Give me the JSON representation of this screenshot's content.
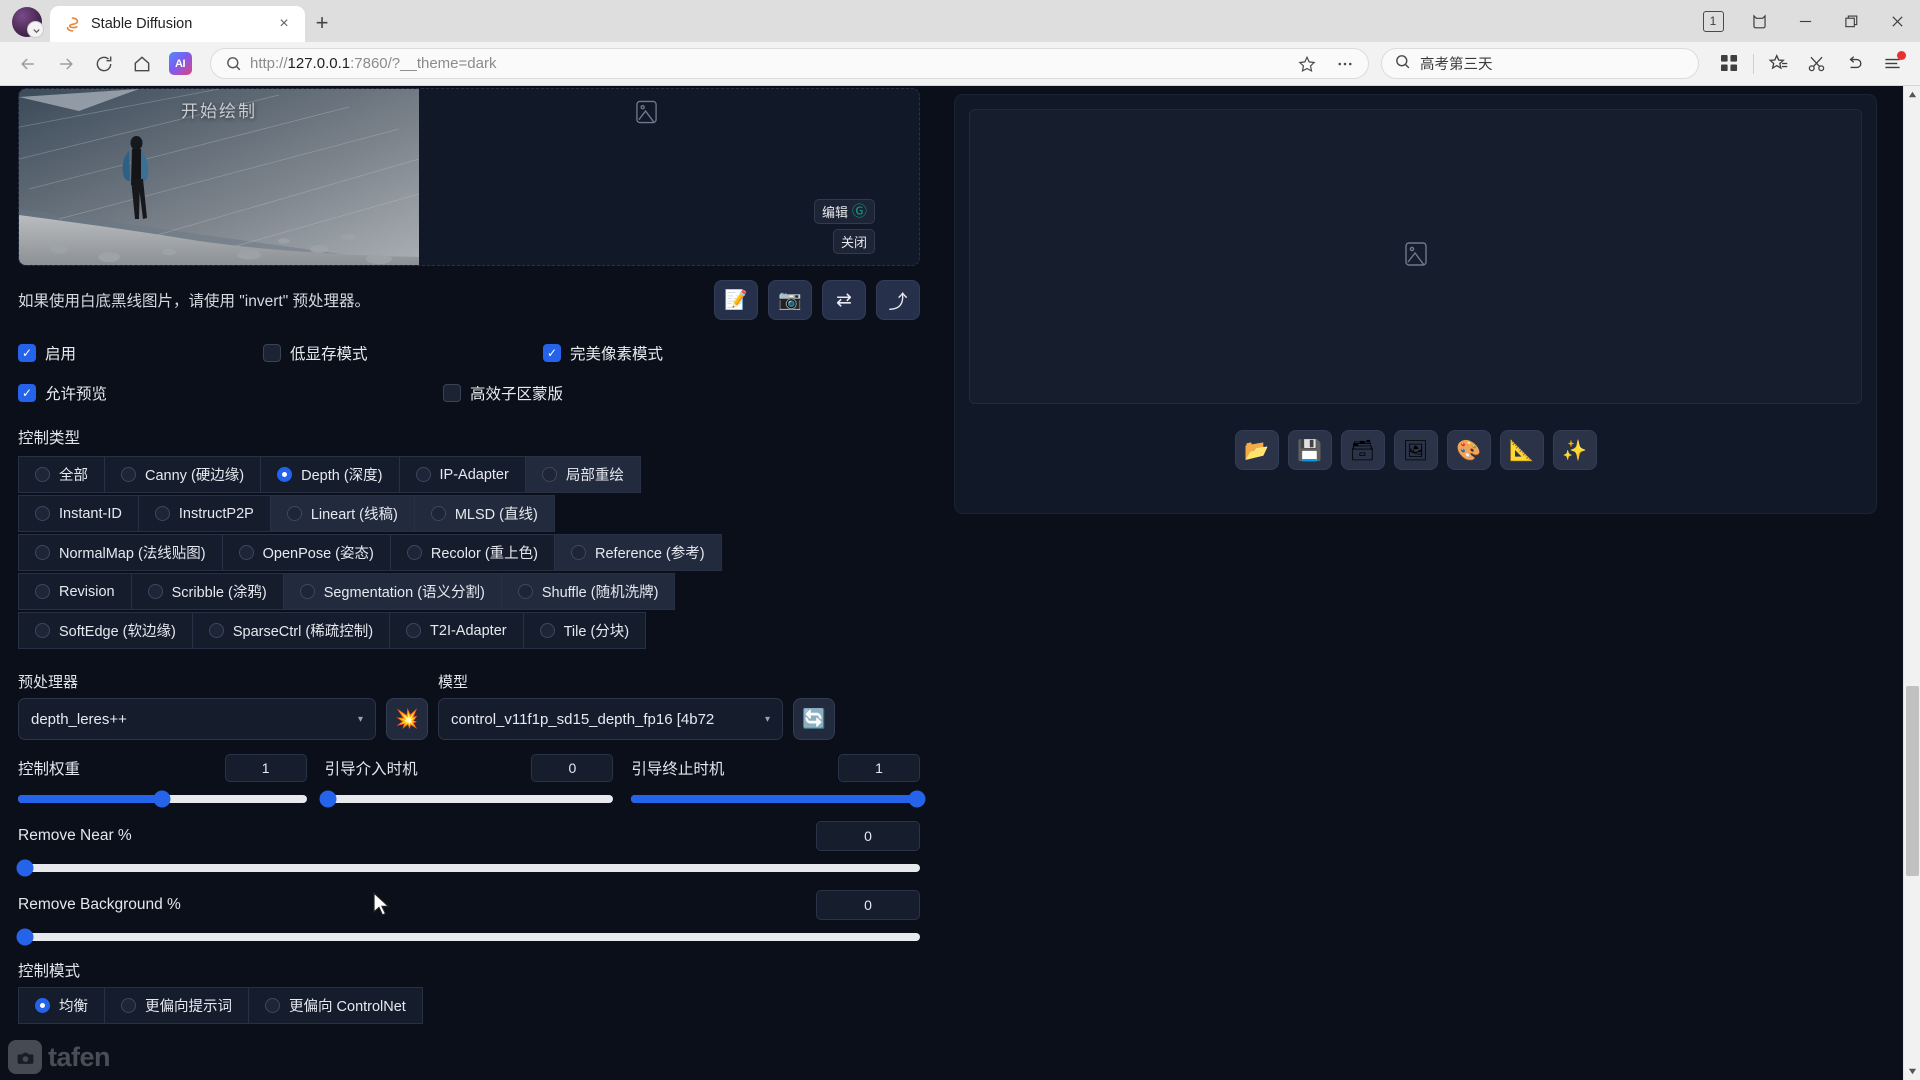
{
  "browser": {
    "tab": {
      "title": "Stable Diffusion",
      "favicon": "stable-diffusion-favicon",
      "close": "×"
    },
    "new_tab": "+",
    "window_controls": {
      "tab_count": "1",
      "collections": "collections-icon",
      "minimize": "—",
      "maximize": "maximize-icon",
      "close": "✕"
    },
    "toolbar": {
      "back": "←",
      "forward": "→",
      "reload": "⟳",
      "home": "⌂",
      "ai_badge": "AI",
      "url_prefix": "http://",
      "url_host": "127.0.0.1",
      "url_suffix": ":7860/?__theme=dark",
      "url_full": "http://127.0.0.1:7860/?__theme=dark",
      "bookmark": "☆",
      "more": "⋯",
      "search_query": "高考第三天",
      "apps": "apps-grid-icon",
      "favorites": "favorites-star-icon",
      "clip": "scissors-icon",
      "undo": "undo-arrow-icon",
      "menu": "hamburger-menu-icon"
    }
  },
  "controlnet": {
    "image": {
      "overlay_text": "开始绘制",
      "edit_label": "编辑",
      "edit_icon": "Ⓖ",
      "close_label": "关闭",
      "placeholder_icon": "image-placeholder-icon"
    },
    "hint": "如果使用白底黑线图片，请使用 \"invert\" 预处理器。",
    "tool_buttons": [
      {
        "name": "memo-icon",
        "glyph": "📝"
      },
      {
        "name": "camera-icon",
        "glyph": "📷"
      },
      {
        "name": "swap-arrows-icon",
        "glyph": "⇄"
      },
      {
        "name": "send-arrow-icon",
        "glyph": "⤴"
      }
    ],
    "checkboxes_row1": [
      {
        "label": "启用",
        "checked": true
      },
      {
        "label": "低显存模式",
        "checked": false
      },
      {
        "label": "完美像素模式",
        "checked": true
      }
    ],
    "checkboxes_row2": [
      {
        "label": "允许预览",
        "checked": true
      },
      {
        "label": "高效子区蒙版",
        "checked": false
      }
    ],
    "control_type_label": "控制类型",
    "control_types": [
      [
        {
          "label": "全部",
          "selected": false
        },
        {
          "label": "Canny (硬边缘)",
          "selected": false
        },
        {
          "label": "Depth (深度)",
          "selected": true
        },
        {
          "label": "IP-Adapter",
          "selected": false
        },
        {
          "label": "局部重绘",
          "selected": false,
          "hover": true
        }
      ],
      [
        {
          "label": "Instant-ID",
          "selected": false
        },
        {
          "label": "InstructP2P",
          "selected": false
        },
        {
          "label": "Lineart (线稿)",
          "selected": false,
          "hover": true
        },
        {
          "label": "MLSD (直线)",
          "selected": false,
          "hover": true
        }
      ],
      [
        {
          "label": "NormalMap (法线贴图)",
          "selected": false
        },
        {
          "label": "OpenPose (姿态)",
          "selected": false
        },
        {
          "label": "Recolor (重上色)",
          "selected": false
        },
        {
          "label": "Reference (参考)",
          "selected": false,
          "hover": true
        }
      ],
      [
        {
          "label": "Revision",
          "selected": false
        },
        {
          "label": "Scribble (涂鸦)",
          "selected": false
        },
        {
          "label": "Segmentation (语义分割)",
          "selected": false,
          "hover": true
        },
        {
          "label": "Shuffle (随机洗牌)",
          "selected": false,
          "hover": true
        }
      ],
      [
        {
          "label": "SoftEdge (软边缘)",
          "selected": false
        },
        {
          "label": "SparseCtrl (稀疏控制)",
          "selected": false
        },
        {
          "label": "T2I-Adapter",
          "selected": false
        },
        {
          "label": "Tile (分块)",
          "selected": false
        }
      ]
    ],
    "preprocessor": {
      "label": "预处理器",
      "value": "depth_leres++",
      "caret": "▾"
    },
    "explode_button": "💥",
    "model": {
      "label": "模型",
      "value": "control_v11f1p_sd15_depth_fp16 [4b72",
      "caret": "▾"
    },
    "refresh_button": "🔄",
    "sliders": [
      {
        "label": "控制权重",
        "value": "1",
        "fill_pct": 50,
        "knob_pct": 50
      },
      {
        "label": "引导介入时机",
        "value": "0",
        "fill_pct": 0,
        "knob_pct": 0
      },
      {
        "label": "引导终止时机",
        "value": "1",
        "fill_pct": 100,
        "knob_pct": 100
      }
    ],
    "wide_sliders": [
      {
        "label": "Remove Near %",
        "value": "0",
        "fill_pct": 0,
        "knob_pct": 0
      },
      {
        "label": "Remove Background %",
        "value": "0",
        "fill_pct": 0,
        "knob_pct": 0
      }
    ],
    "control_mode_label": "控制模式",
    "control_modes": [
      {
        "label": "均衡",
        "selected": true
      },
      {
        "label": "更偏向提示词",
        "selected": false
      },
      {
        "label": "更偏向 ControlNet",
        "selected": false
      }
    ]
  },
  "gallery": {
    "placeholder_icon": "image-placeholder-icon",
    "tools": [
      {
        "name": "open-folder-icon",
        "glyph": "📂"
      },
      {
        "name": "save-floppy-icon",
        "glyph": "💾"
      },
      {
        "name": "card-file-box-icon",
        "glyph": "🗃"
      },
      {
        "name": "framed-picture-icon",
        "glyph": "🖼"
      },
      {
        "name": "palette-icon",
        "glyph": "🎨"
      },
      {
        "name": "triangular-ruler-icon",
        "glyph": "📐"
      },
      {
        "name": "sparkles-icon",
        "glyph": "✨"
      }
    ]
  },
  "watermark": {
    "text": "tafen",
    "logo": "camera-logo-icon"
  },
  "colors": {
    "accent": "#2563eb",
    "bg": "#0b0f19",
    "panel": "#111827",
    "text": "#e6e9f0"
  }
}
